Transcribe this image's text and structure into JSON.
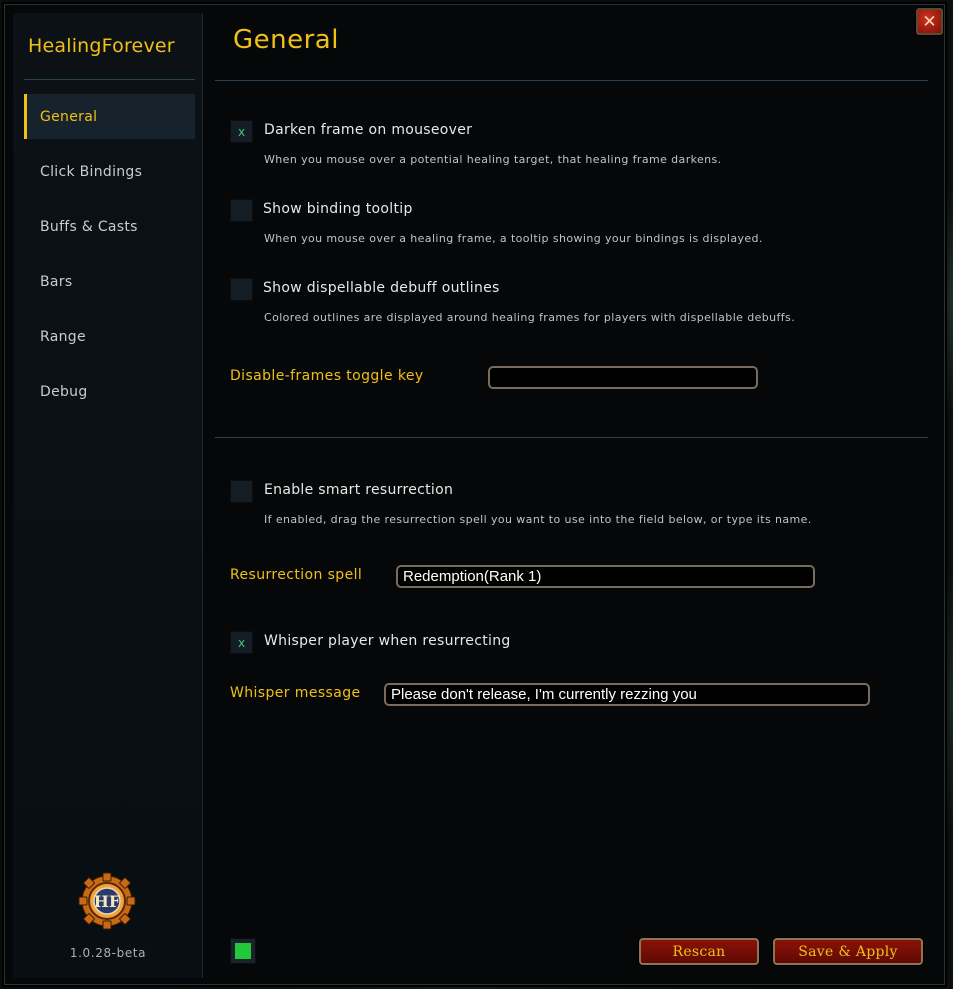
{
  "sidebar": {
    "title": "HealingForever",
    "items": [
      {
        "label": "General",
        "active": true
      },
      {
        "label": "Click Bindings",
        "active": false
      },
      {
        "label": "Buffs & Casts",
        "active": false
      },
      {
        "label": "Bars",
        "active": false
      },
      {
        "label": "Range",
        "active": false
      },
      {
        "label": "Debug",
        "active": false
      }
    ],
    "logo_text": "HF",
    "version": "1.0.28-beta"
  },
  "close_icon": "✕",
  "main": {
    "title": "General",
    "options": {
      "darken": {
        "checked": true,
        "mark": "x",
        "label": "Darken frame on mouseover",
        "desc": "When you mouse over a potential healing target, that healing frame darkens."
      },
      "tooltip": {
        "checked": false,
        "mark": "",
        "label": "Show binding tooltip",
        "desc": "When you mouse over a healing frame, a tooltip showing your bindings is displayed."
      },
      "outlines": {
        "checked": false,
        "mark": "",
        "label": "Show dispellable debuff outlines",
        "desc": "Colored outlines are displayed around healing frames for players with dispellable debuffs."
      },
      "toggle_key": {
        "label": "Disable-frames toggle key",
        "value": ""
      },
      "smart_res": {
        "checked": false,
        "mark": "",
        "label": "Enable smart resurrection",
        "desc": "If enabled, drag the resurrection spell you want to use into the field below, or type its name."
      },
      "res_spell": {
        "label": "Resurrection spell",
        "value": "Redemption(Rank 1)"
      },
      "whisper": {
        "checked": true,
        "mark": "x",
        "label": "Whisper player when resurrecting"
      },
      "whisper_message": {
        "label": "Whisper message",
        "value": "Please don't release, I'm currently rezzing you"
      }
    }
  },
  "footer": {
    "status_color": "#22c83c",
    "rescan_label": "Rescan",
    "save_label": "Save & Apply"
  },
  "colors": {
    "accent": "#f0c018",
    "button_red": "#8a1208",
    "check_green": "#3ec87a"
  }
}
